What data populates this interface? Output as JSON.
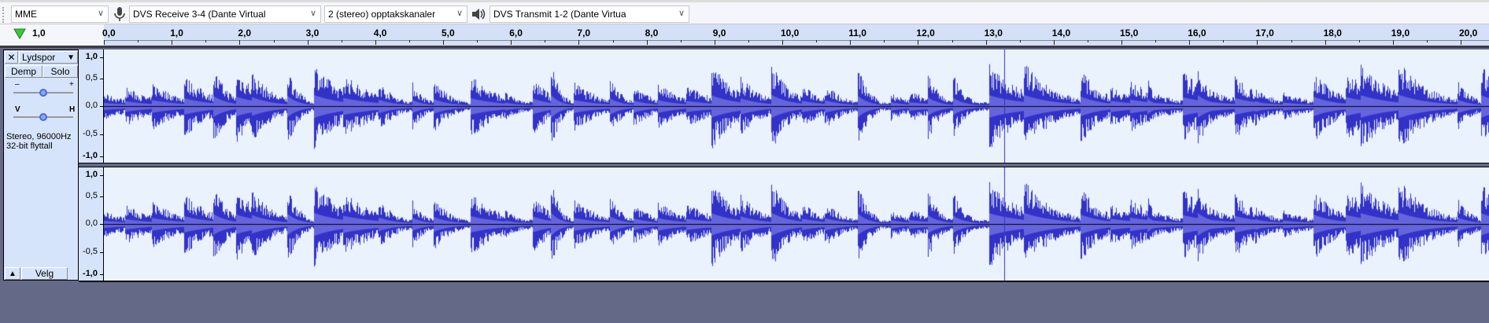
{
  "toolbar": {
    "host": "MME",
    "recording_device": "DVS Receive  3-4 (Dante Virtual",
    "recording_channels": "2 (stereo) opptakskanaler",
    "playback_device": "DVS Transmit  1-2 (Dante Virtua",
    "chevron": "∨"
  },
  "ruler": {
    "left_label": "1,0",
    "ticks": [
      "0,0",
      "1,0",
      "2,0",
      "3,0",
      "4,0",
      "5,0",
      "6,0",
      "7,0",
      "8,0",
      "9,0",
      "10,0",
      "11,0",
      "12,0",
      "13,0",
      "14,0",
      "15,0",
      "16,0",
      "17,0",
      "18,0",
      "19,0",
      "20,0"
    ]
  },
  "track": {
    "close": "✕",
    "name": "Lydspor",
    "menu_arrow": "▼",
    "mute": "Demp",
    "solo": "Solo",
    "gain_minus": "–",
    "gain_plus": "+",
    "pan_left": "V",
    "pan_right": "H",
    "gain": 0.5,
    "pan": 0.5,
    "info_line1": "Stereo, 96000Hz",
    "info_line2": "32-bit flyttall",
    "collapse": "▲",
    "select": "Velg"
  },
  "vruler": [
    "1,0",
    "0,5",
    "0,0",
    "-0,5",
    "-1,0"
  ],
  "colors": {
    "wave": "#3232c8",
    "rms": "#6464dc",
    "wave_bg": "#eaf2fe"
  }
}
